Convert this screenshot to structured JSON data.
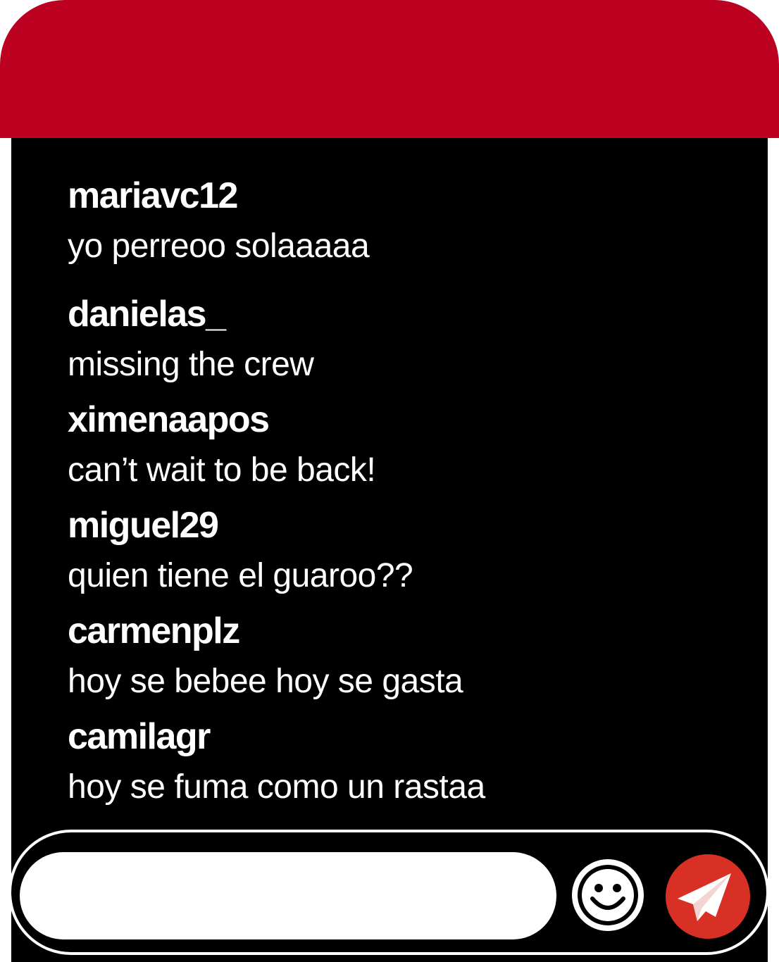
{
  "colors": {
    "header": "#bb0020",
    "chat_background": "#000000",
    "text": "#ffffff",
    "send_button": "#d93025"
  },
  "messages": [
    {
      "user": "mariavc12",
      "text": "yo perreoo solaaaaa"
    },
    {
      "user": "danielas_",
      "text": "missing the crew"
    },
    {
      "user": "ximenaapos",
      "text": "can’t wait to be back!"
    },
    {
      "user": "miguel29",
      "text": "quien tiene el guaroo??"
    },
    {
      "user": "carmenplz",
      "text": "hoy se bebee hoy se gasta"
    },
    {
      "user": "camilagr",
      "text": "hoy se fuma como un rastaa"
    }
  ],
  "composer": {
    "value": "",
    "emoji_icon": "smiley-face-icon",
    "send_icon": "paper-plane-icon"
  }
}
